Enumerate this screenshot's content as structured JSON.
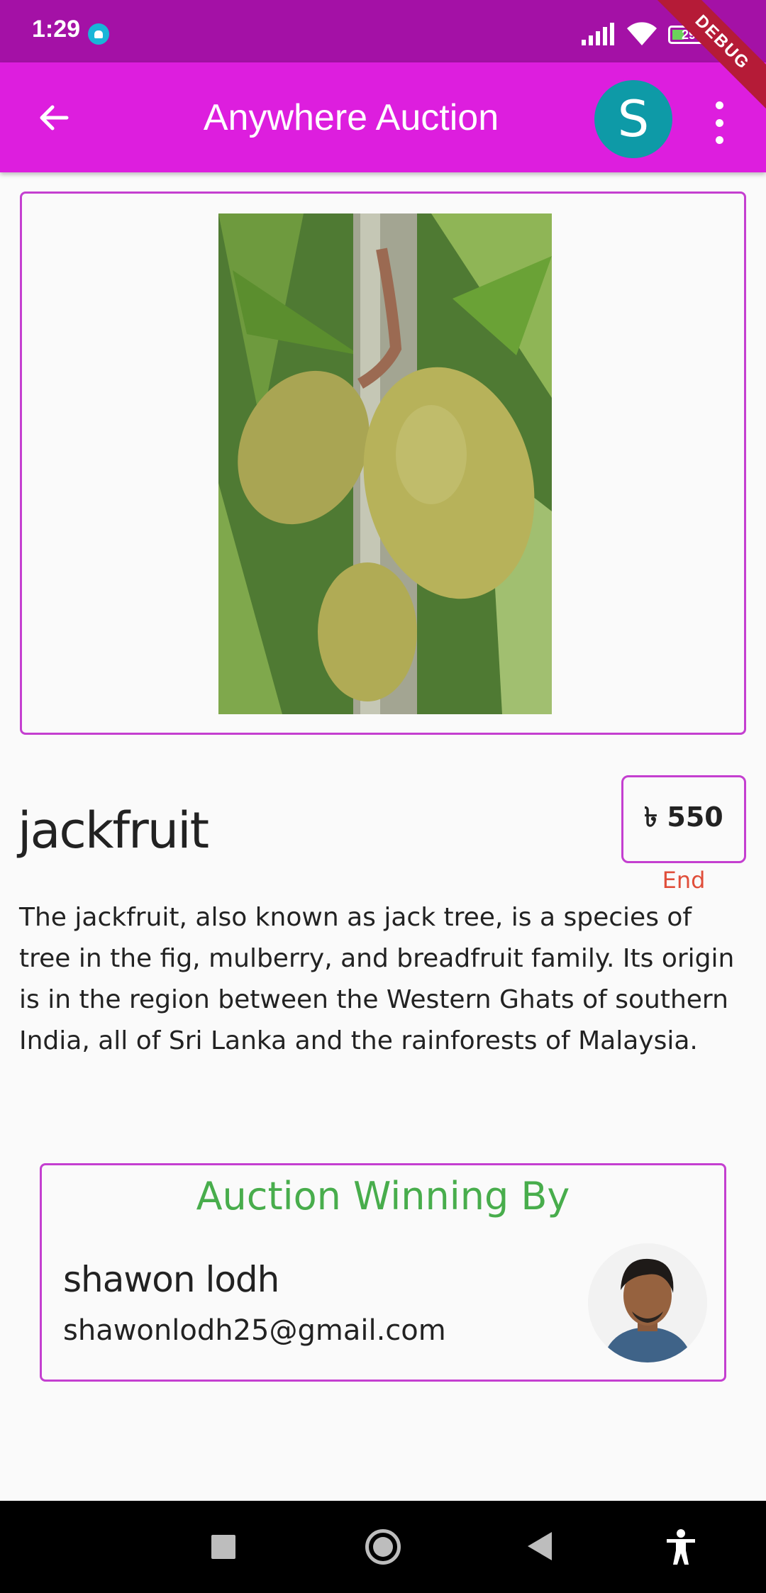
{
  "status_bar": {
    "time": "1:29",
    "battery": "29"
  },
  "debug_banner": "DEBUG",
  "app_bar": {
    "title": "Anywhere Auction",
    "avatar_initial": "S"
  },
  "product": {
    "title": "jackfruit",
    "price": "৳ 550",
    "status": "End",
    "description": "The jackfruit, also known as jack tree, is a species of tree in the fig, mulberry, and breadfruit family. Its origin is in the region between the Western Ghats of southern India, all of Sri Lanka and the rainforests of Malaysia."
  },
  "winner": {
    "heading": "Auction Winning By",
    "name": "shawon lodh",
    "email": "shawonlodh25@gmail.com"
  },
  "colors": {
    "status_bar": "#a411a6",
    "app_bar": "#dd1ede",
    "card_border": "#c43fd0",
    "avatar": "#0e9aa7",
    "end_status": "#e04e3a",
    "winner_heading": "#48ad4c"
  },
  "icons": {
    "back": "arrow-left-icon",
    "menu": "more-vert-icon",
    "nav_recent": "square-icon",
    "nav_home": "circle-icon",
    "nav_back": "triangle-back-icon",
    "nav_accessibility": "accessibility-icon"
  }
}
